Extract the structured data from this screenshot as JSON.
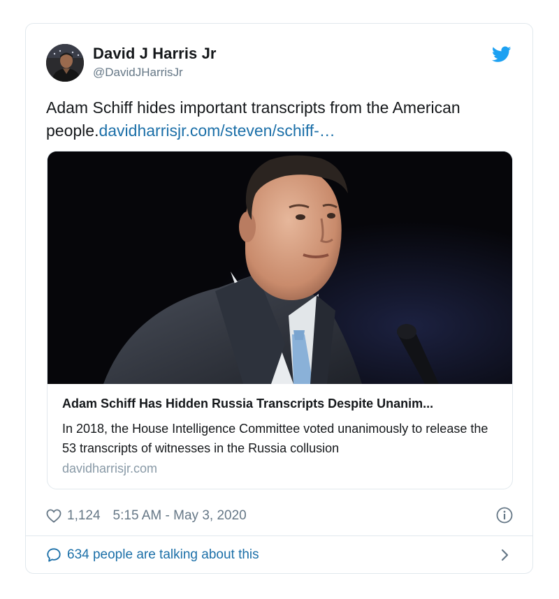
{
  "tweet": {
    "author": {
      "display_name": "David J Harris Jr",
      "handle": "@DavidJHarrisJr"
    },
    "text": "Adam Schiff hides important transcripts from the American people.",
    "link_text": "davidharrisjr.com/steven/schiff-…",
    "card": {
      "title": "Adam Schiff Has Hidden Russia Transcripts Despite Unanim...",
      "description": "In 2018, the House Intelligence Committee voted unanimously to release the 53 transcripts of witnesses in the Russia collusion",
      "domain": "davidharrisjr.com"
    },
    "like_count": "1,124",
    "timestamp": "5:15 AM - May 3, 2020",
    "talking_text": "634 people are talking about this"
  },
  "colors": {
    "twitter_blue": "#1da1f2",
    "link_blue": "#1b6fa8",
    "text_primary": "#14171a",
    "text_secondary": "#657786",
    "border": "#e1e8ed"
  },
  "icons": {
    "brand": "twitter-bird-icon",
    "like": "heart-icon",
    "info": "info-icon",
    "reply": "speech-bubble-icon",
    "navigate": "chevron-right-icon"
  }
}
